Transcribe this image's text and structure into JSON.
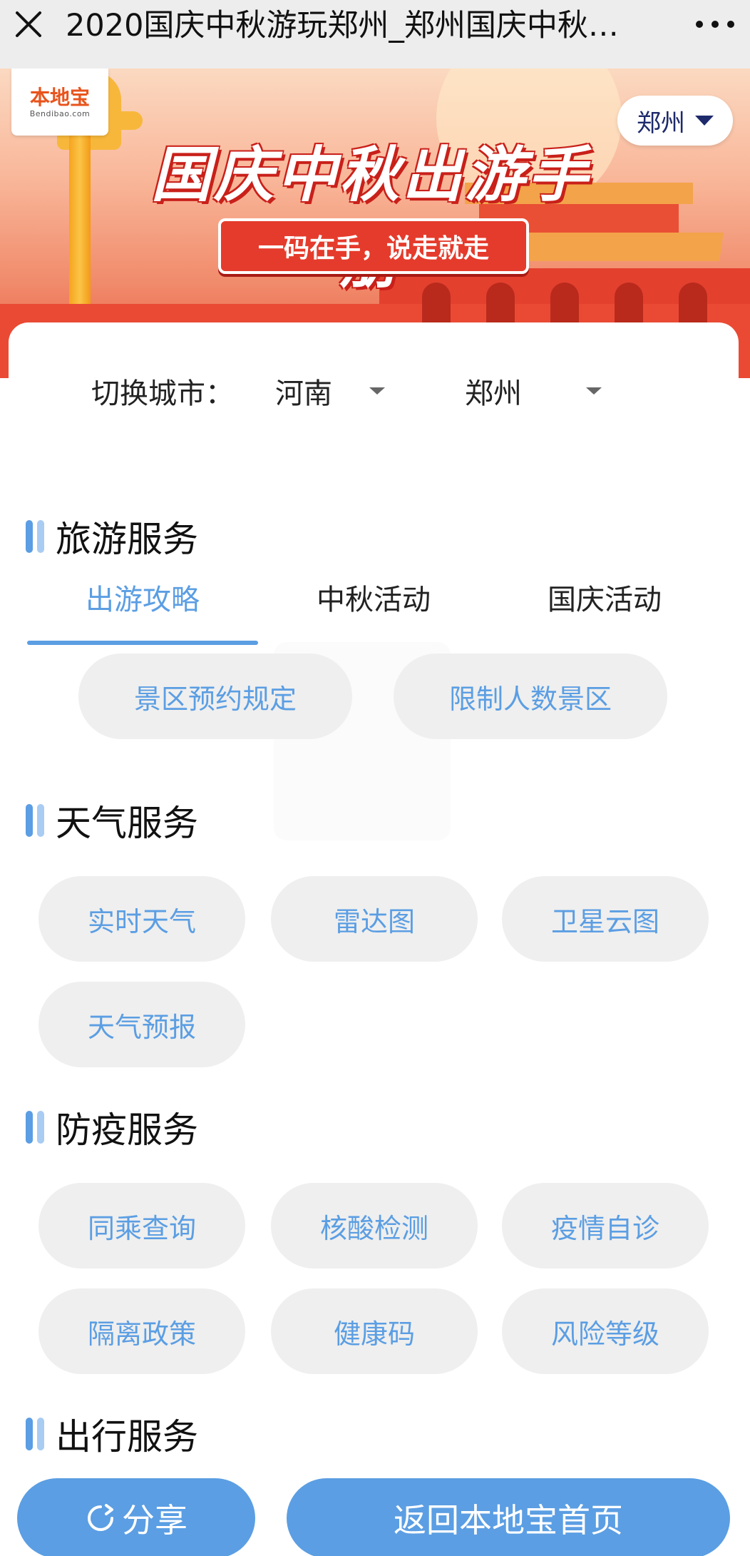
{
  "topbar": {
    "close_icon": "close-icon",
    "title": "2020国庆中秋游玩郑州_郑州国庆中秋…",
    "more_icon": "more-icon"
  },
  "banner": {
    "logo_main": "本地宝",
    "logo_sub": "Bendibao.com",
    "city": "郑州",
    "title": "国庆中秋出游手册",
    "slogan": "一码在手，说走就走"
  },
  "city_switch": {
    "label": "切换城市：",
    "province": "河南",
    "city": "郑州"
  },
  "sections": {
    "travel": {
      "title": "旅游服务",
      "tabs": [
        "出游攻略",
        "中秋活动",
        "国庆活动"
      ],
      "active_tab": "出游攻略",
      "items": [
        "景区预约规定",
        "限制人数景区"
      ]
    },
    "weather": {
      "title": "天气服务",
      "items": [
        "实时天气",
        "雷达图",
        "卫星云图",
        "天气预报"
      ]
    },
    "epidemic": {
      "title": "防疫服务",
      "items": [
        "同乘查询",
        "核酸检测",
        "疫情自诊",
        "隔离政策",
        "健康码",
        "风险等级"
      ]
    },
    "transport": {
      "title": "出行服务"
    }
  },
  "footer": {
    "share_label": "分享",
    "home_label": "返回本地宝首页"
  },
  "colors": {
    "accent": "#5b9ee3",
    "accent_light": "#a9ccf2",
    "pill_bg": "#efefef",
    "topbar_bg": "#ededed"
  }
}
